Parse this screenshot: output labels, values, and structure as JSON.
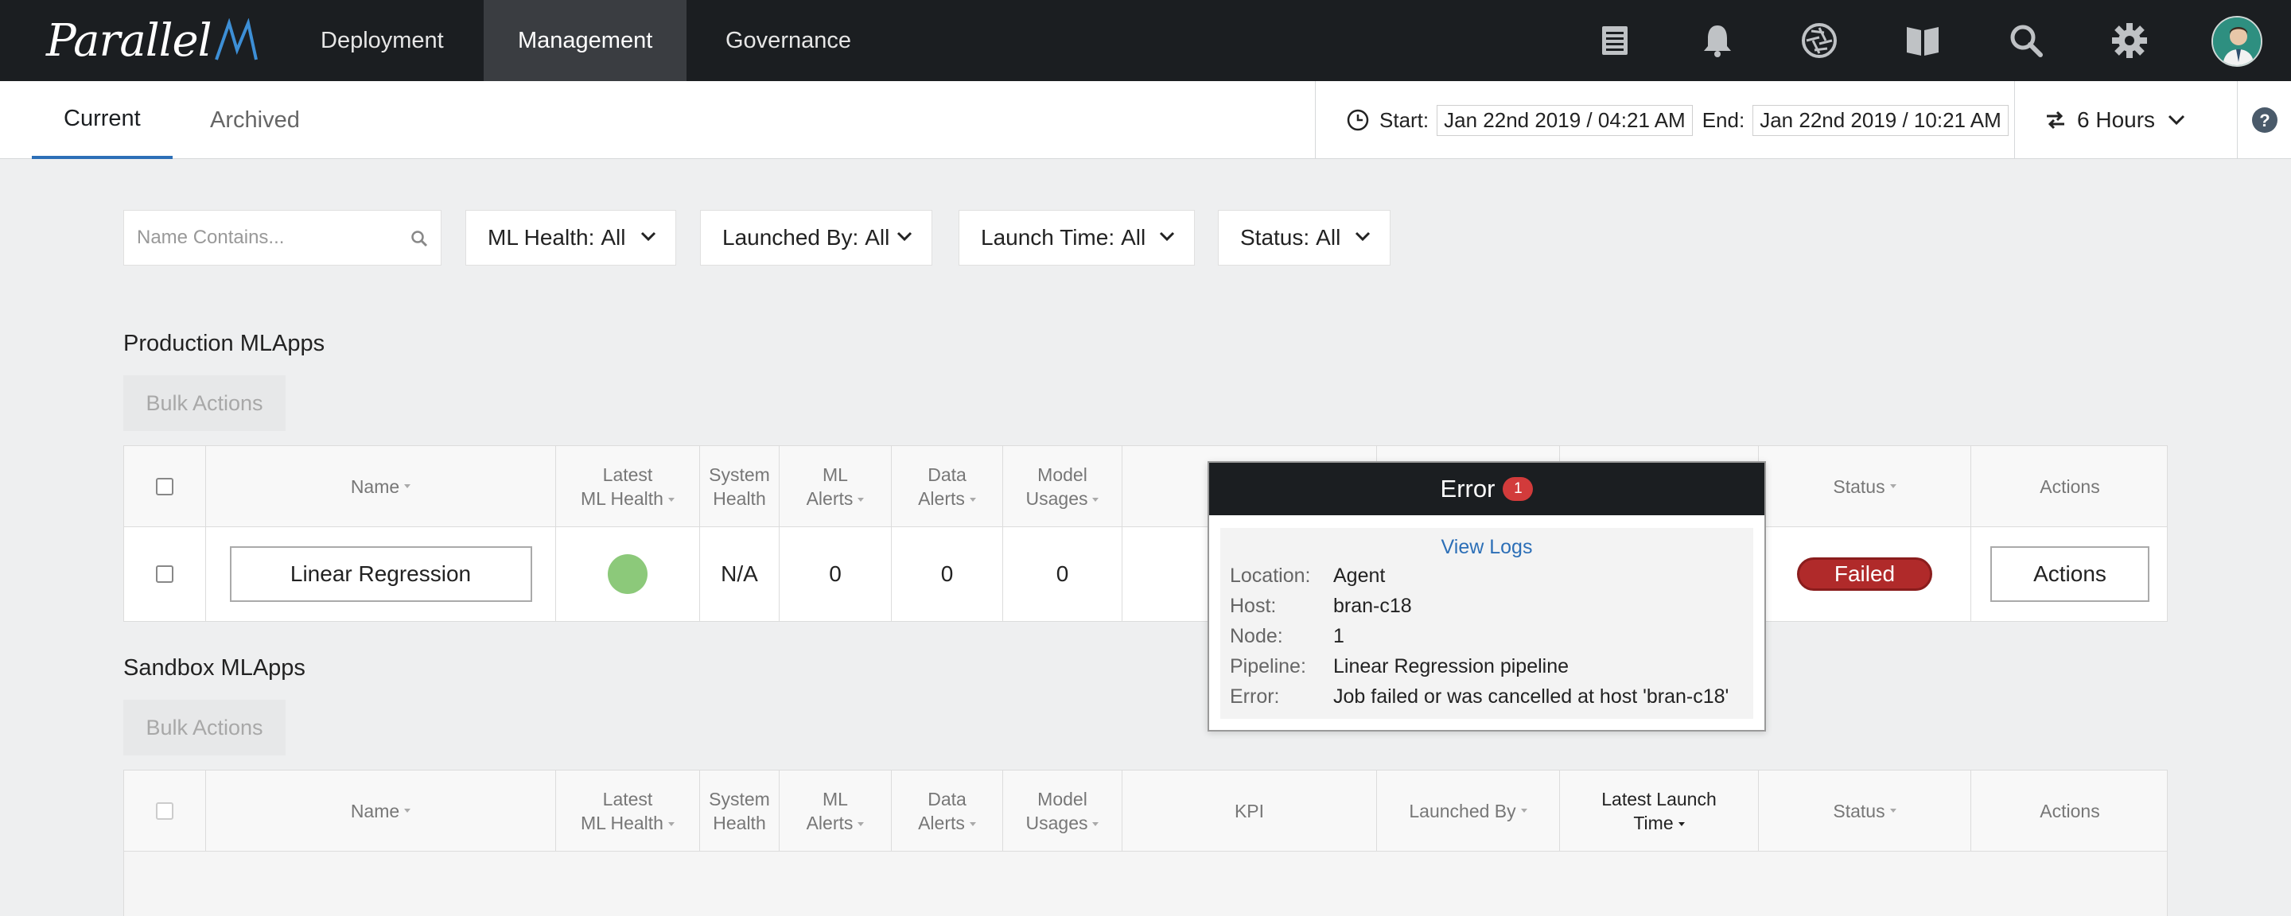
{
  "brand": {
    "logo_text": "Parallel"
  },
  "topnav": {
    "items": [
      {
        "label": "Deployment",
        "active": false
      },
      {
        "label": "Management",
        "active": true
      },
      {
        "label": "Governance",
        "active": false
      }
    ],
    "icons": [
      "reports-icon",
      "bell-icon",
      "aperture-icon",
      "book-icon",
      "search-icon",
      "gear-icon",
      "avatar"
    ]
  },
  "subnav": {
    "tabs": [
      {
        "label": "Current",
        "active": true
      },
      {
        "label": "Archived",
        "active": false
      }
    ],
    "time_range": {
      "start_label": "Start:",
      "start_value": "Jan 22nd 2019 / 04:21 AM",
      "end_label": "End:",
      "end_value": "Jan 22nd 2019 / 10:21 AM"
    },
    "duration_label": "6 Hours"
  },
  "filters": {
    "search_placeholder": "Name Contains...",
    "items": [
      {
        "label": "ML Health:",
        "value": "All"
      },
      {
        "label": "Launched By:",
        "value": "All"
      },
      {
        "label": "Launch Time:",
        "value": "All"
      },
      {
        "label": "Status:",
        "value": "All"
      }
    ]
  },
  "production": {
    "title": "Production MLApps",
    "bulk_label": "Bulk Actions",
    "columns": {
      "name": "Name",
      "latest_health_1": "Latest",
      "latest_health_2": "ML Health",
      "system_health_1": "System",
      "system_health_2": "Health",
      "ml_alerts_1": "ML",
      "ml_alerts_2": "Alerts",
      "data_alerts_1": "Data",
      "data_alerts_2": "Alerts",
      "model_usages_1": "Model",
      "model_usages_2": "Usages",
      "status": "Status",
      "actions": "Actions"
    },
    "rows": [
      {
        "name": "Linear Regression",
        "system_health": "N/A",
        "ml_alerts": "0",
        "data_alerts": "0",
        "model_usages": "0",
        "status": "Failed",
        "actions_label": "Actions"
      }
    ]
  },
  "sandbox": {
    "title": "Sandbox MLApps",
    "bulk_label": "Bulk Actions",
    "columns": {
      "name": "Name",
      "latest_health_1": "Latest",
      "latest_health_2": "ML Health",
      "system_health_1": "System",
      "system_health_2": "Health",
      "ml_alerts_1": "ML",
      "ml_alerts_2": "Alerts",
      "data_alerts_1": "Data",
      "data_alerts_2": "Alerts",
      "model_usages_1": "Model",
      "model_usages_2": "Usages",
      "kpi": "KPI",
      "launched_by": "Launched By",
      "latest_launch_1": "Latest Launch",
      "latest_launch_2": "Time",
      "status": "Status",
      "actions": "Actions"
    }
  },
  "error_popup": {
    "title": "Error",
    "count": "1",
    "view_logs": "View Logs",
    "fields": [
      {
        "key": "Location:",
        "value": "Agent"
      },
      {
        "key": "Host:",
        "value": "bran-c18"
      },
      {
        "key": "Node:",
        "value": "1"
      },
      {
        "key": "Pipeline:",
        "value": "Linear Regression pipeline"
      },
      {
        "key": "Error:",
        "value": "Job failed or was cancelled at host 'bran-c18'"
      }
    ]
  },
  "colors": {
    "topnav_bg": "#1b1e21",
    "accent": "#2c6fb7",
    "health_ok": "#8cc97a",
    "status_failed": "#b02a2a",
    "badge": "#d23b3b"
  }
}
